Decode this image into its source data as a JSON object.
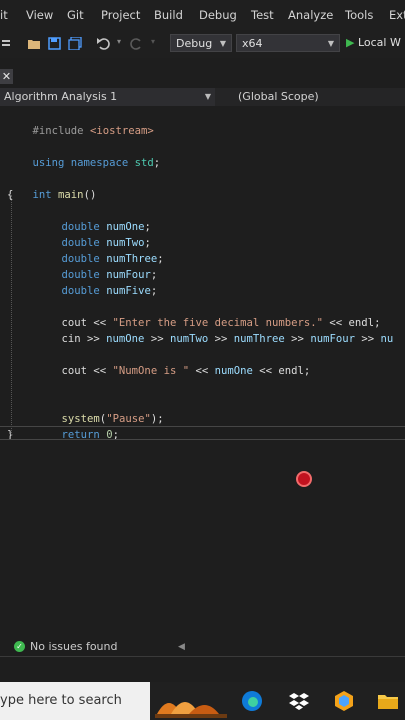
{
  "menu": [
    "it",
    "View",
    "Git",
    "Project",
    "Build",
    "Debug",
    "Test",
    "Analyze",
    "Tools",
    "Ext"
  ],
  "toolbar": {
    "config": "Debug",
    "platform": "x64",
    "run_label": "Local W",
    "colors": {
      "run": "#3fb950",
      "save": "#4f9dff",
      "undo": "#c5c5c5"
    }
  },
  "tabstrip": {
    "close_glyph": "✕"
  },
  "navbar": {
    "project": "Algorithm Analysis 1",
    "scope": "(Global Scope)"
  },
  "code": {
    "include_dir": "#include",
    "include_file": "<iostream>",
    "using": "using",
    "namespace_kw": "namespace",
    "std": "std",
    "int_kw": "int",
    "main_fn": "main",
    "double_kw": "double",
    "vars": [
      "numOne",
      "numTwo",
      "numThree",
      "numFour",
      "numFive"
    ],
    "cout": "cout",
    "cin": "cin",
    "endl": "endl",
    "prompt_str": "\"Enter the five decimal numbers.\"",
    "numone_str": "\"NumOne is \"",
    "system_fn": "system",
    "pause_str": "\"Pause\"",
    "return_kw": "return",
    "zero": "0",
    "nu_trunc": "nu"
  },
  "status": {
    "issues": "No issues found"
  },
  "taskbar": {
    "search_placeholder": "ype here to search"
  }
}
